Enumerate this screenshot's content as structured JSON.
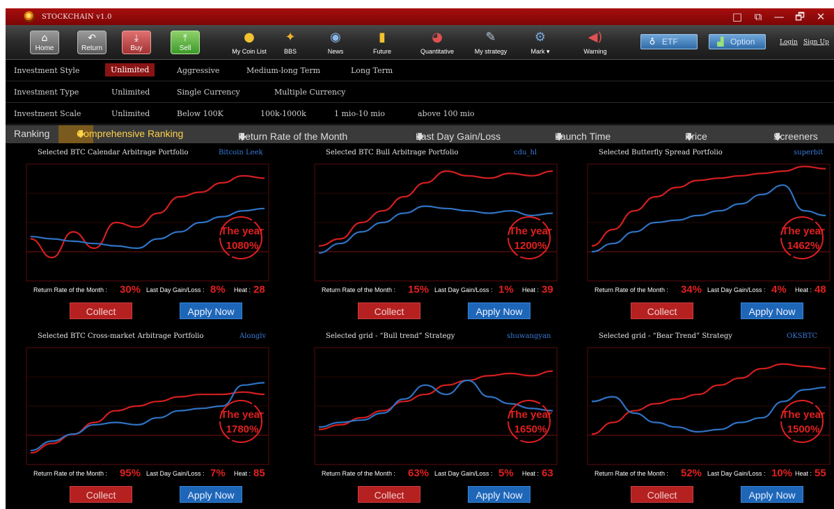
{
  "app": {
    "title": "STOCKCHAIN v1.0"
  },
  "window_controls": [
    "□",
    "⧉",
    "—",
    "🗗",
    "✕"
  ],
  "toolbar": {
    "home": "Home",
    "return": "Return",
    "buy": "Buy",
    "sell": "Sell",
    "items": [
      {
        "label": "My Coin List",
        "icon": "coin-list-icon"
      },
      {
        "label": "BBS",
        "icon": "bbs-icon"
      },
      {
        "label": "News",
        "icon": "news-icon"
      },
      {
        "label": "Future",
        "icon": "future-icon"
      },
      {
        "label": "Quantitative",
        "icon": "quantitative-icon"
      },
      {
        "label": "My strategy",
        "icon": "strategy-icon"
      },
      {
        "label": "Mark ▾",
        "icon": "mark-icon"
      },
      {
        "label": "Warning",
        "icon": "warning-icon"
      }
    ],
    "etf": "ETF",
    "option": "Option",
    "login": "Login",
    "signup": "Sign Up"
  },
  "filters": {
    "style": {
      "label": "Investment Style",
      "options": [
        "Unlimited",
        "Aggressive",
        "Medium-long Term",
        "Long Term"
      ]
    },
    "type": {
      "label": "Investment Type",
      "options": [
        "Unlimited",
        "Single Currency",
        "Multiple Currency"
      ]
    },
    "scale": {
      "label": "Investment Scale",
      "options": [
        "Unlimited",
        "Below 100K",
        "100k-1000k",
        "1 mio-10 mio",
        "above 100 mio"
      ]
    }
  },
  "ranking": {
    "label": "Ranking",
    "tabs": [
      "Comprehensive Ranking",
      "Return Rate of the Month",
      "Last Day Gain/Loss",
      "Launch Time",
      "Price",
      "Screeners"
    ]
  },
  "labels": {
    "month": "Return Rate of the Month :",
    "gain": "Last Day Gain/Loss :",
    "heat": "Heat :",
    "collect": "Collect",
    "apply": "Apply Now",
    "the_year": "The year"
  },
  "colors": {
    "red_line": "#d41f1f",
    "blue_line": "#2f73c4",
    "accent_red": "#e12020",
    "grid": "#5a0c0c"
  },
  "portfolios": [
    {
      "title": "Selected BTC Calendar Arbitrage Portfolio",
      "author": "Bitcoin Leek",
      "year": "1080%",
      "month": "30%",
      "gain": "8%",
      "heat": "28",
      "red": [
        0.36,
        0.2,
        0.42,
        0.28,
        0.5,
        0.46,
        0.58,
        0.72,
        0.76,
        0.84,
        0.9,
        0.88
      ],
      "blue": [
        0.38,
        0.36,
        0.34,
        0.32,
        0.3,
        0.28,
        0.36,
        0.42,
        0.5,
        0.55,
        0.6,
        0.62
      ]
    },
    {
      "title": "Selected BTC Bull Arbitrage Portfolio",
      "author": "cdu_hl",
      "year": "1200%",
      "month": "15%",
      "gain": "1%",
      "heat": "39",
      "red": [
        0.3,
        0.36,
        0.5,
        0.6,
        0.72,
        0.84,
        0.94,
        0.9,
        0.88,
        0.92,
        0.9,
        0.94
      ],
      "blue": [
        0.24,
        0.32,
        0.42,
        0.5,
        0.58,
        0.64,
        0.62,
        0.6,
        0.58,
        0.6,
        0.56,
        0.58
      ]
    },
    {
      "title": "Selected Butterfly Spread Portfolio",
      "author": "superbit",
      "year": "1462%",
      "month": "34%",
      "gain": "4%",
      "heat": "48",
      "red": [
        0.3,
        0.44,
        0.6,
        0.72,
        0.8,
        0.86,
        0.88,
        0.9,
        0.92,
        0.94,
        0.98,
        0.96
      ],
      "blue": [
        0.25,
        0.32,
        0.42,
        0.5,
        0.52,
        0.56,
        0.6,
        0.66,
        0.74,
        0.82,
        0.6,
        0.56
      ]
    },
    {
      "title": "Selected BTC Cross-market Arbitrage Portfolio",
      "author": "Alonglv",
      "year": "1780%",
      "month": "95%",
      "gain": "7%",
      "heat": "85",
      "red": [
        0.1,
        0.18,
        0.26,
        0.36,
        0.46,
        0.5,
        0.54,
        0.58,
        0.6,
        0.6,
        0.62,
        0.6
      ],
      "blue": [
        0.12,
        0.2,
        0.26,
        0.34,
        0.36,
        0.34,
        0.4,
        0.46,
        0.48,
        0.5,
        0.68,
        0.7
      ]
    },
    {
      "title": "Selected grid - “Bull trend” Strategy",
      "author": "shuwangyan",
      "year": "1650%",
      "month": "63%",
      "gain": "5%",
      "heat": "63",
      "red": [
        0.3,
        0.34,
        0.4,
        0.46,
        0.54,
        0.6,
        0.68,
        0.72,
        0.76,
        0.78,
        0.76,
        0.8
      ],
      "blue": [
        0.32,
        0.36,
        0.38,
        0.44,
        0.56,
        0.68,
        0.6,
        0.72,
        0.58,
        0.52,
        0.48,
        0.46
      ]
    },
    {
      "title": "Selected grid - “Bear Trend” Strategy",
      "author": "OKSBTC",
      "year": "1500%",
      "month": "52%",
      "gain": "10%",
      "heat": "55",
      "red": [
        0.26,
        0.36,
        0.46,
        0.52,
        0.56,
        0.6,
        0.68,
        0.74,
        0.82,
        0.86,
        0.84,
        0.82
      ],
      "blue": [
        0.54,
        0.58,
        0.44,
        0.36,
        0.32,
        0.28,
        0.3,
        0.36,
        0.4,
        0.54,
        0.64,
        0.66
      ]
    }
  ]
}
